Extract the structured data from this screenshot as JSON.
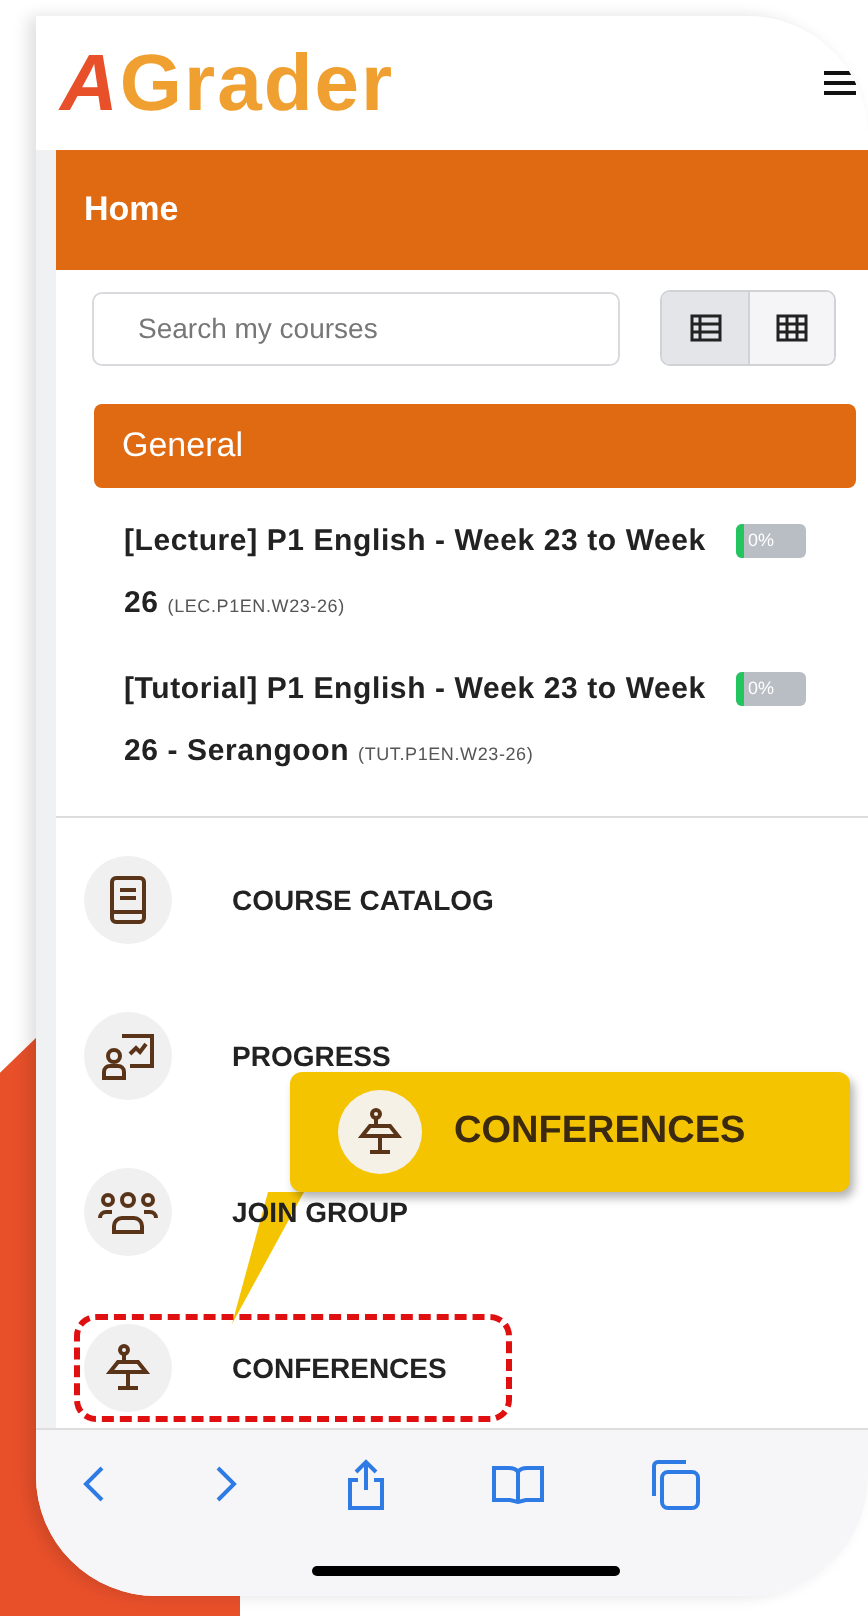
{
  "logo": {
    "mark": "A",
    "text": "Grader"
  },
  "page_title": "Home",
  "search": {
    "placeholder": "Search my courses"
  },
  "view_toggle": [
    {
      "kind": "list",
      "selected": true
    },
    {
      "kind": "grid",
      "selected": false
    }
  ],
  "section": {
    "title": "General",
    "courses": [
      {
        "name": "[Lecture] P1 English - Week 23 to Week 26",
        "code": "(LEC.P1EN.W23-26)",
        "progress": "0%",
        "level": 0
      },
      {
        "name": "[Tutorial] P1 English - Week 23 to Week 26 - Serangoon",
        "code": "(TUT.P1EN.W23-26)",
        "progress": "0%",
        "level": 0
      }
    ]
  },
  "nav_items": [
    {
      "kind": "catalog",
      "label": "COURSE CATALOG",
      "highlighted": false
    },
    {
      "kind": "progress",
      "label": "PROGRESS",
      "highlighted": false
    },
    {
      "kind": "group",
      "label": "JOIN GROUP",
      "highlighted": false
    },
    {
      "kind": "conference",
      "label": "CONFERENCES",
      "highlighted": true
    }
  ],
  "callout": {
    "kind": "conference",
    "label": "CONFERENCES"
  },
  "browser_toolbar": [
    {
      "kind": "back"
    },
    {
      "kind": "forward"
    },
    {
      "kind": "share"
    },
    {
      "kind": "bookmarks"
    },
    {
      "kind": "tabs"
    }
  ]
}
